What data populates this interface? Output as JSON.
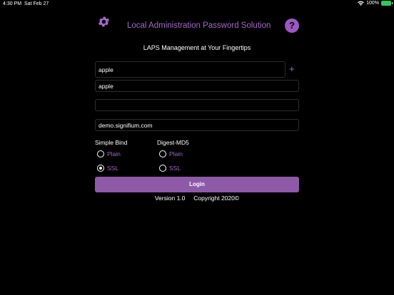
{
  "status_bar": {
    "time": "4:30 PM",
    "date": "Sat Feb 27",
    "battery_text": "100%"
  },
  "header": {
    "title": "Local Administration Password Solution",
    "help_label": "?",
    "subtitle": "LAPS Management at Your Fingertips"
  },
  "form": {
    "computer_name_value": "apple",
    "add_label": "+",
    "username_value": "apple",
    "password_value": "",
    "server_value": "demo.signifium.com"
  },
  "simple_bind": {
    "label": "Simple Bind",
    "plain_label": "Plain",
    "ssl_label": "SSL",
    "selected": "SSL"
  },
  "digest_md5": {
    "label": "Digest-MD5",
    "plain_label": "Plain",
    "ssl_label": "SSL",
    "selected": ""
  },
  "login_label": "Login",
  "footer": {
    "version": "Version 1.0",
    "copyright": "Copyright 2020©"
  },
  "colors": {
    "accent": "#a568c9",
    "button": "#8e5aa8",
    "background": "#000000"
  }
}
